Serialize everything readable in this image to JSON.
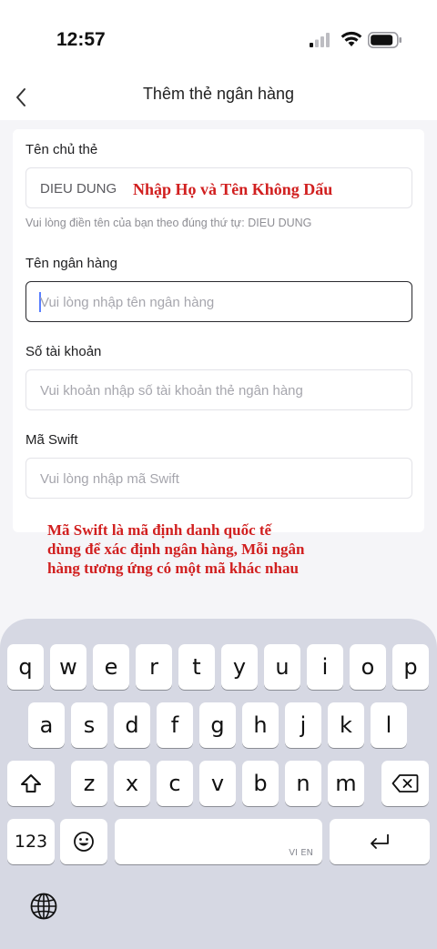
{
  "status": {
    "time": "12:57"
  },
  "nav": {
    "title": "Thêm thẻ ngân hàng"
  },
  "form": {
    "holder": {
      "label": "Tên chủ thẻ",
      "value": "DIEU DUNG",
      "helper": "Vui lòng điền tên của bạn theo đúng thứ tự: DIEU DUNG"
    },
    "bank": {
      "label": "Tên ngân hàng",
      "placeholder": "Vui lòng nhập tên ngân hàng"
    },
    "account": {
      "label": "Số tài khoản",
      "placeholder": "Vui khoản nhập số tài khoản thẻ ngân hàng"
    },
    "swift": {
      "label": "Mã Swift",
      "placeholder": "Vui lòng nhập mã Swift"
    }
  },
  "annotations": {
    "name_note": "Nhập Họ và Tên Không Dấu",
    "swift_note_line1": "Mã Swift là mã định danh quốc tế",
    "swift_note_line2": "dùng để xác định ngân hàng, Mỗi ngân",
    "swift_note_line3": "hàng tương ứng có một mã khác nhau",
    "color": "#d11f1f"
  },
  "keyboard": {
    "row1": [
      "q",
      "w",
      "e",
      "r",
      "t",
      "y",
      "u",
      "i",
      "o",
      "p"
    ],
    "row2": [
      "a",
      "s",
      "d",
      "f",
      "g",
      "h",
      "j",
      "k",
      "l"
    ],
    "row3": [
      "z",
      "x",
      "c",
      "v",
      "b",
      "n",
      "m"
    ],
    "numbers_label": "123",
    "space_lang": "VI EN",
    "icons": [
      "shift-icon",
      "backspace-icon",
      "emoji-icon",
      "return-icon",
      "globe-icon"
    ]
  }
}
